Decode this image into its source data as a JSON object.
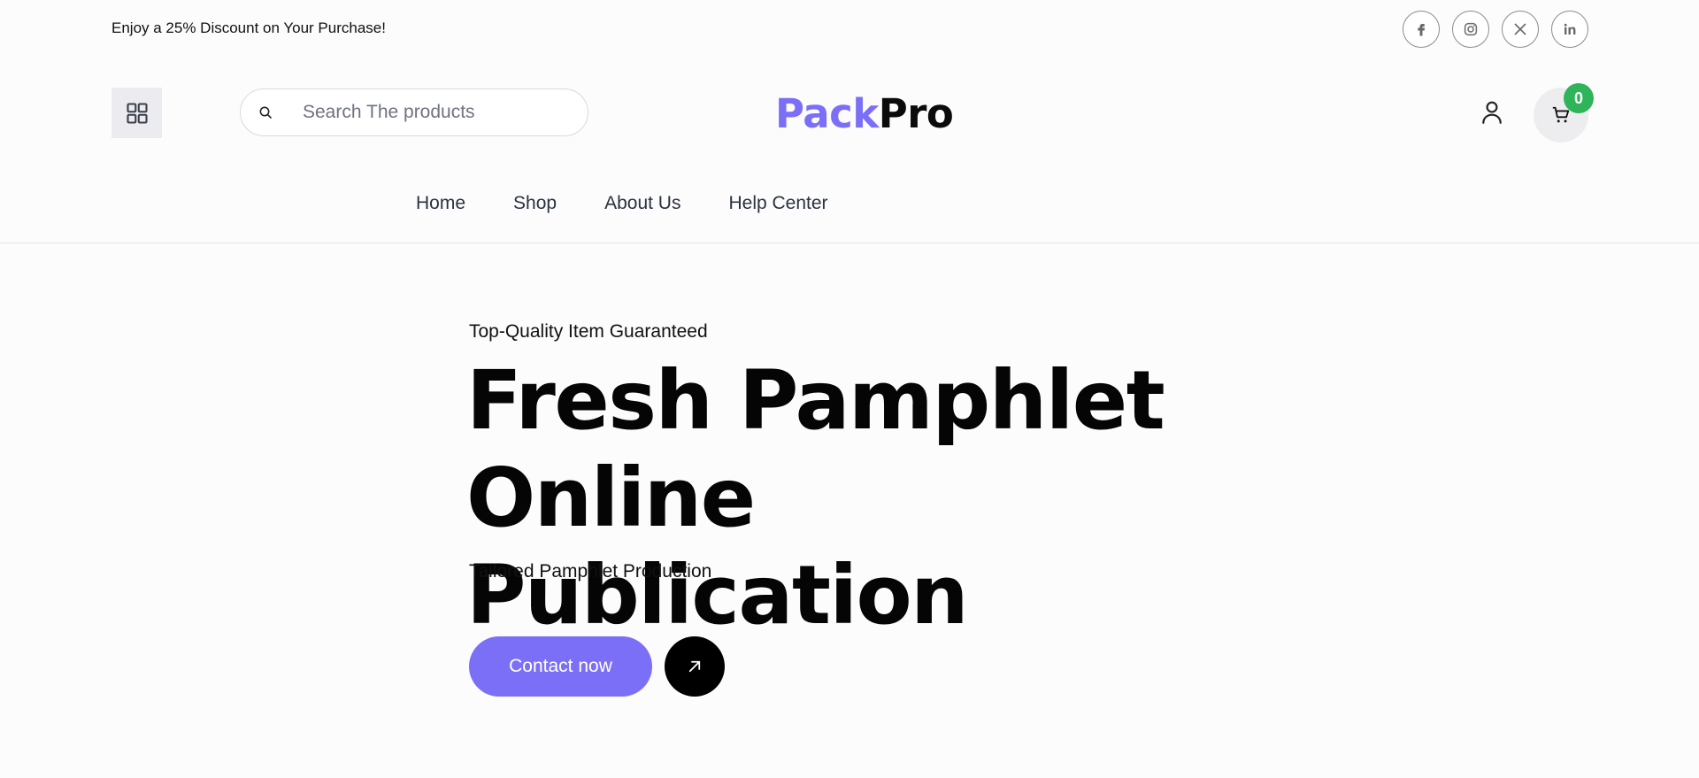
{
  "topbar": {
    "promo_text": "Enjoy a 25% Discount on Your Purchase!",
    "socials": [
      {
        "icon": "facebook-icon"
      },
      {
        "icon": "instagram-icon"
      },
      {
        "icon": "x-twitter-icon"
      },
      {
        "icon": "linkedin-icon"
      }
    ]
  },
  "header": {
    "search_placeholder": "Search The products",
    "logo": {
      "part1": "Pack",
      "part2": "Pro"
    },
    "cart_count": "0"
  },
  "nav": {
    "items": [
      "Home",
      "Shop",
      "About Us",
      "Help Center"
    ]
  },
  "hero": {
    "kicker": "Top-Quality Item Guaranteed",
    "title_line1": "Fresh Pamphlet Online",
    "title_line2": "Publication",
    "subtitle": "Tailored Pamphlet Production",
    "cta_label": "Contact now"
  },
  "colors": {
    "accent": "#7c6ff7",
    "badge": "#2fb45a",
    "text": "#050505"
  }
}
